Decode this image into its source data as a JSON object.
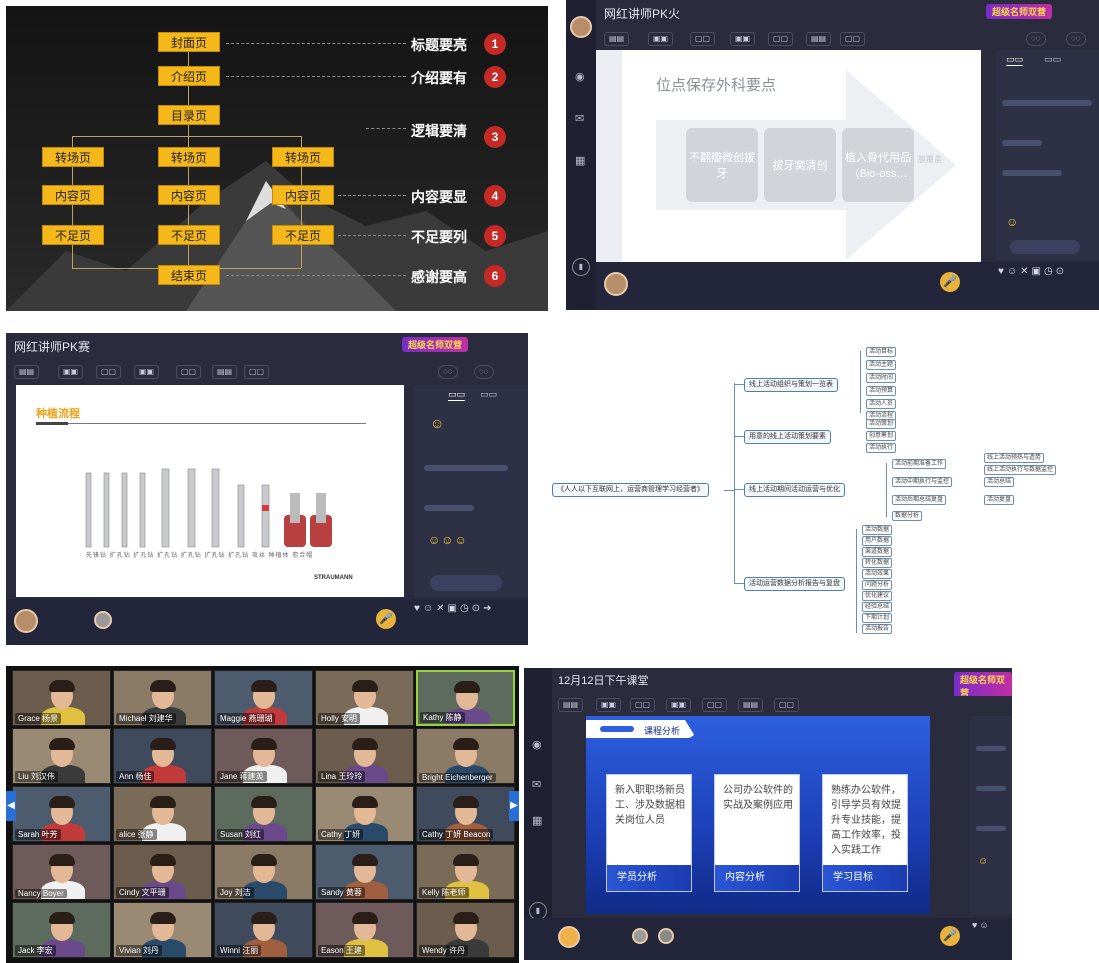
{
  "slide_structure": {
    "center_boxes": [
      "封面页",
      "介绍页",
      "目录页",
      "转场页",
      "内容页",
      "不足页",
      "结束页"
    ],
    "left_boxes": [
      "转场页",
      "内容页",
      "不足页"
    ],
    "right_boxes": [
      "转场页",
      "内容页",
      "不足页"
    ],
    "labels": [
      "标题要亮",
      "介绍要有",
      "逻辑要清",
      "内容要显",
      "不足要列",
      "感谢要高"
    ],
    "numbers": [
      "1",
      "2",
      "3",
      "4",
      "5",
      "6"
    ]
  },
  "class2": {
    "title": "网红讲师PK火",
    "slide_title": "位点保存外科要点",
    "steps": [
      "不翻瓣微创拔牙",
      "拔牙窝清创",
      "植入骨代用品（Bio-oss…"
    ],
    "arrow_tail": "膜覆盖",
    "brand": "超级名师双营"
  },
  "class3": {
    "title": "网红讲师PK赛",
    "slide_title": "种植流程",
    "brand": "超级名师双营",
    "tools": [
      "先锋钻",
      "扩孔钻",
      "扩孔钻",
      "扩孔钻",
      "扩孔钻",
      "扩孔钻",
      "扩孔钻",
      "攻丝",
      "种植体",
      "愈合帽"
    ],
    "footer_logo": "STRAUMANN"
  },
  "mindmap": {
    "root": "《人人以下互联网上，运营商管理学习经营者》",
    "branches": [
      "线上活动组织与策划一览表",
      "用意的线上活动策划要素",
      "线上活动期间活动运营与优化",
      "活动运营数据分析报告与复盘"
    ],
    "leaves_a": [
      "活动目标",
      "活动主题",
      "活动时间",
      "活动预算",
      "活动人员",
      "活动流程"
    ],
    "leaves_b": [
      "活动策划",
      "创意筹划",
      "活动执行"
    ],
    "leaves_c": [
      "活动前期准备工作",
      "活动中期执行与监控",
      "活动后期总结复盘",
      "数据分析"
    ],
    "leaves_c2": [
      "线上活动预热与造势",
      "线上活动执行与数据监控",
      "活动总结",
      "活动复盘"
    ],
    "leaves_d": [
      "活动数据",
      "用户数据",
      "渠道数据",
      "转化数据",
      "活动效果",
      "问题分析",
      "优化建议",
      "经验总结",
      "下期计划",
      "活动报告"
    ]
  },
  "video_grid": {
    "names": [
      [
        "Grace 杨景",
        "Michael 刘建华",
        "Maggie 燕珊瑚",
        "Holly 安明",
        "Kathy 陈静"
      ],
      [
        "Liu 刘汉伟",
        "Ann 杨佳",
        "Jane 蒋建英",
        "Lina 王玲玲",
        "Bright Eichenberger"
      ],
      [
        "Sarah 叶芳",
        "alice 张静",
        "Susan 刘红",
        "Cathy 丁妍",
        "Cathy 丁妍 Beacon"
      ],
      [
        "Nancy Boyer",
        "Cindy 文平珊",
        "Joy 刘洁",
        "Sandy 黄蓉",
        "Kelly 陈老师"
      ],
      [
        "Jack 李宏",
        "Vivian 刘丹",
        "Winni 汪丽",
        "Eason 王建",
        "Wendy 许丹"
      ]
    ]
  },
  "class6": {
    "title": "12月12日下午课堂",
    "section": "课程分析",
    "cards": [
      {
        "text": "新入职职场新员工、涉及数据相关岗位人员",
        "foot": "学员分析"
      },
      {
        "text": "公司办公软件的实战及案例应用",
        "foot": "内容分析"
      },
      {
        "text": "熟练办公软件，引导学员有效提升专业技能，提高工作效率，投入实践工作",
        "foot": "学习目标"
      }
    ],
    "brand": "超级名师双营"
  },
  "colors": {
    "accent_yellow": "#f5b81a",
    "number_red": "#c52a26",
    "card_blue": "#1b3cb0"
  }
}
